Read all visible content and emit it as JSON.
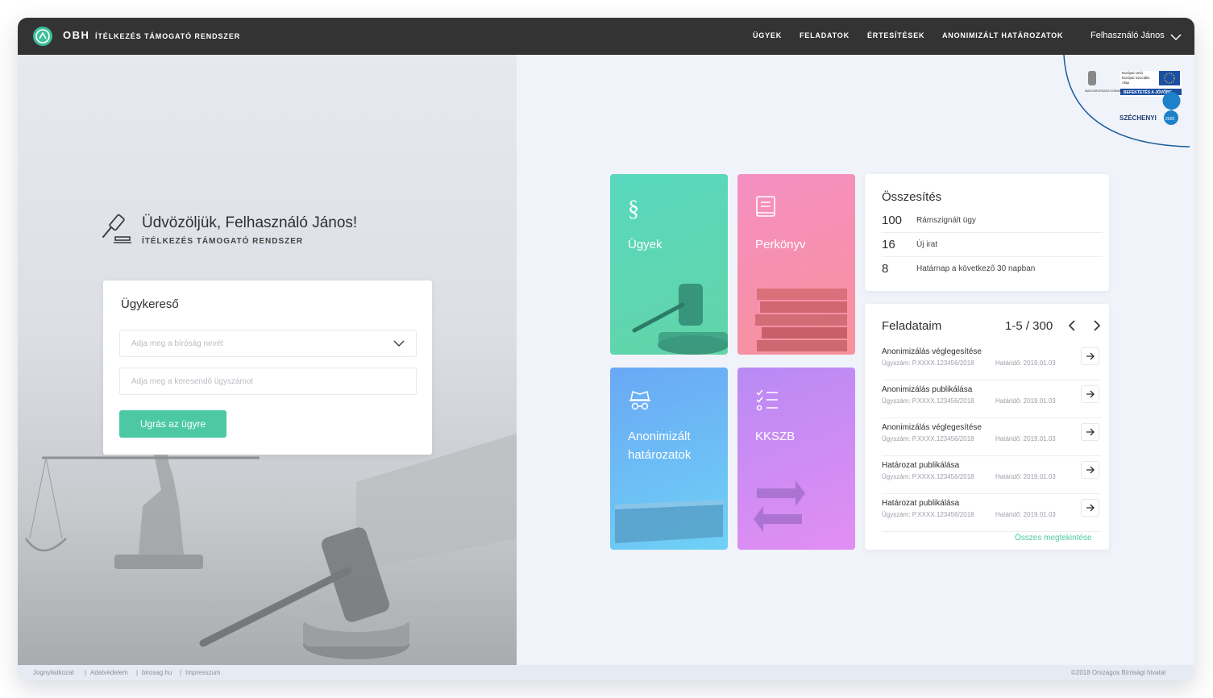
{
  "header": {
    "logo_abbr": "OBH",
    "app_name": "ÍTÉLKEZÉS TÁMOGATÓ RENDSZER",
    "nav": [
      "ÜGYEK",
      "FELADATOK",
      "ÉRTESÍTÉSEK",
      "ANONIMIZÁLT HATÁROZATOK"
    ],
    "user_name": "Felhasználó János"
  },
  "badge": {
    "eu_line1": "Európai Unió",
    "eu_line2": "Európai Szociális",
    "eu_line3": "Alap",
    "hu_gov": "MAGYARORSZÁG KORMÁNYA",
    "invest": "BEFEKTETÉS A JÖVŐBE",
    "szechenyi": "SZÉCHENYI",
    "year": "2020"
  },
  "welcome": {
    "title": "Üdvözöljük, Felhasználó János!",
    "subtitle": "ÍTÉLKEZÉS TÁMOGATÓ RENDSZER"
  },
  "search": {
    "title": "Ügykereső",
    "court_placeholder": "Adja meg a bíróság nevét",
    "case_placeholder": "Adja meg a keresendő ügyszámot",
    "button": "Ugrás az ügyre"
  },
  "tiles": {
    "ugyek": "Ügyek",
    "perkonyv": "Perkönyv",
    "anon_line1": "Anonimizált",
    "anon_line2": "határozatok",
    "kkszb": "KKSZB"
  },
  "summary": {
    "title": "Összesítés",
    "rows": [
      {
        "num": "100",
        "label": "Rámszignált ügy"
      },
      {
        "num": "16",
        "label": "Új irat"
      },
      {
        "num": "8",
        "label": "Határnap a következő 30 napban"
      }
    ]
  },
  "tasks": {
    "title": "Feladataim",
    "pagination": "1-5 / 300",
    "items": [
      {
        "title": "Anonimizálás véglegesítése",
        "case": "Ügyszám: P.XXXX.123456/2018",
        "deadline": "Határidő: 2019.01.03"
      },
      {
        "title": "Anonimizálás publikálása",
        "case": "Ügyszám: P.XXXX.123456/2018",
        "deadline": "Határidő: 2019.01.03"
      },
      {
        "title": "Anonimizálás véglegesítése",
        "case": "Ügyszám: P.XXXX.123456/2018",
        "deadline": "Határidő: 2019.01.03"
      },
      {
        "title": "Határozat publikálása",
        "case": "Ügyszám: P.XXXX.123456/2018",
        "deadline": "Határidő: 2019.01.03"
      },
      {
        "title": "Határozat publikálása",
        "case": "Ügyszám: P.XXXX.123456/2018",
        "deadline": "Határidő: 2019.01.03"
      }
    ],
    "show_all": "Összes megtekintése"
  },
  "footer": {
    "links": [
      "Jognyilatkozat",
      "Adatvédelem",
      "birosag.hu",
      "Impresszum"
    ],
    "separator": "|",
    "copyright": "©2018 Országos Bírósági hivatal"
  },
  "colors": {
    "accent": "#4cc9a3",
    "header_bg": "#333333",
    "tile_ugyek": "#5fd6b4",
    "tile_perkonyv": "#f58fb8",
    "tile_anon": "#6cc3f4",
    "tile_kkszb": "#c98af4"
  },
  "icons": {
    "logo": "obh-logo-icon",
    "welcome": "gavel-icon",
    "ugyek": "paragraph-icon",
    "perkonyv": "book-icon",
    "anon": "incognito-icon",
    "kkszb": "checklist-icon",
    "task_action": "arrow-right-icon"
  }
}
